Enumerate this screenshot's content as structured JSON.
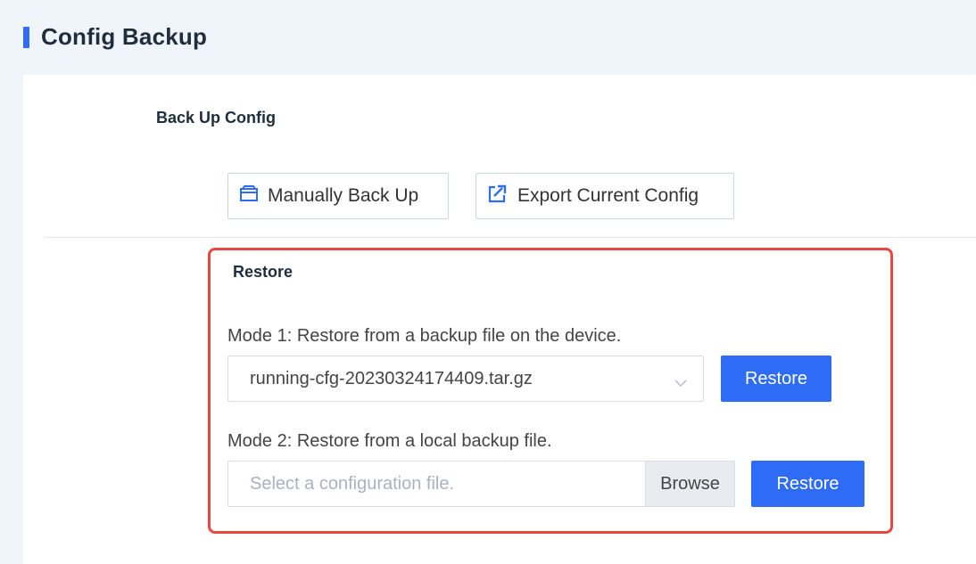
{
  "header": {
    "title": "Config Backup"
  },
  "backup": {
    "title": "Back Up Config",
    "manual_label": "Manually Back Up",
    "export_label": "Export Current Config"
  },
  "restore": {
    "title": "Restore",
    "mode1_text": "Mode 1: Restore from a backup file on the device.",
    "selected_file": "running-cfg-20230324174409.tar.gz",
    "restore1_label": "Restore",
    "mode2_text": "Mode 2: Restore from a local backup file.",
    "file_placeholder": "Select a configuration file.",
    "browse_label": "Browse",
    "restore2_label": "Restore"
  },
  "colors": {
    "accent": "#2f6cf5",
    "highlight_border": "#e8483f"
  }
}
